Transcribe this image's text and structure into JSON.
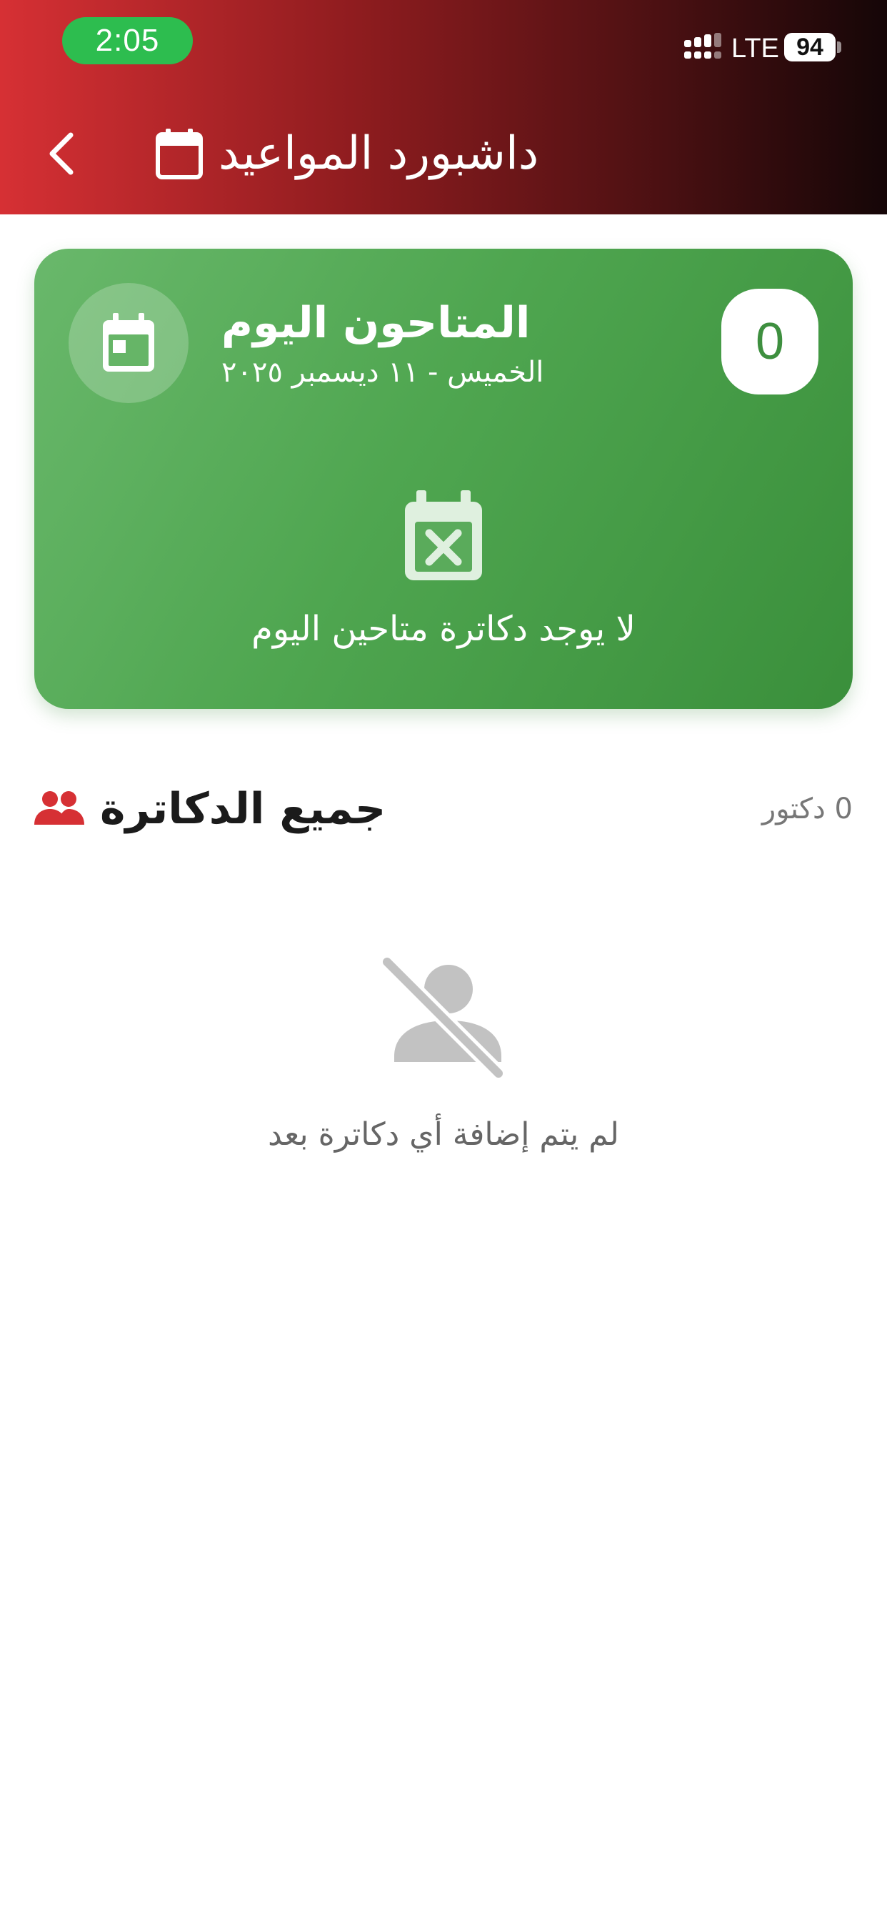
{
  "status_bar": {
    "time": "2:05",
    "network": "LTE",
    "battery": "94"
  },
  "header": {
    "title": "داشبورد المواعيد"
  },
  "today_card": {
    "title": "المتاحون اليوم",
    "date": "الخميس - ١١ ديسمبر ٢٠٢٥",
    "count": "0",
    "empty_message": "لا يوجد دكاترة متاحين اليوم"
  },
  "doctors_section": {
    "title": "جميع الدكاترة",
    "count_label": "0 دكتور",
    "empty_message": "لم يتم إضافة أي دكاترة بعد"
  },
  "colors": {
    "header_start": "#d63034",
    "header_end": "#150607",
    "card_green": "#4fa650",
    "accent_red": "#d63034",
    "time_pill": "#2dbd4f"
  },
  "icons": {
    "back": "chevron-left-icon",
    "header": "calendar-icon",
    "card": "calendar-today-icon",
    "empty_today": "calendar-remove-icon",
    "section": "people-icon",
    "empty_doctors": "person-off-icon"
  }
}
